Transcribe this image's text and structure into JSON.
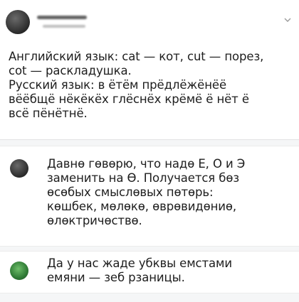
{
  "post": {
    "author_avatar": "avatar-dark",
    "options_icon": "chevron-down-icon",
    "lines": [
      "Английский язык: cat — кот, cut — порез,",
      "cot — раскладушка.",
      "Русский язык: в ётём прёдлёжёнёё",
      "вёёбщё нёкёкёх глёснёх крёмё ё нёт ё",
      "всё пёнётнё."
    ]
  },
  "replies": [
    {
      "avatar": "avatar-dark",
      "lines": [
        "Давнө гөвөрю, что надө Е, О и Э",
        "заменить на Ө. Получается бөз",
        "өсөбых смыслөвых пөтөрь:",
        "көшбек, мөлөкө, өврөвидөниө,",
        "өлөктричөствө."
      ]
    },
    {
      "avatar": "avatar-green",
      "lines": [
        "Да у нас жаде убквы емстами",
        "емяни — зеб рзаницы."
      ]
    }
  ]
}
